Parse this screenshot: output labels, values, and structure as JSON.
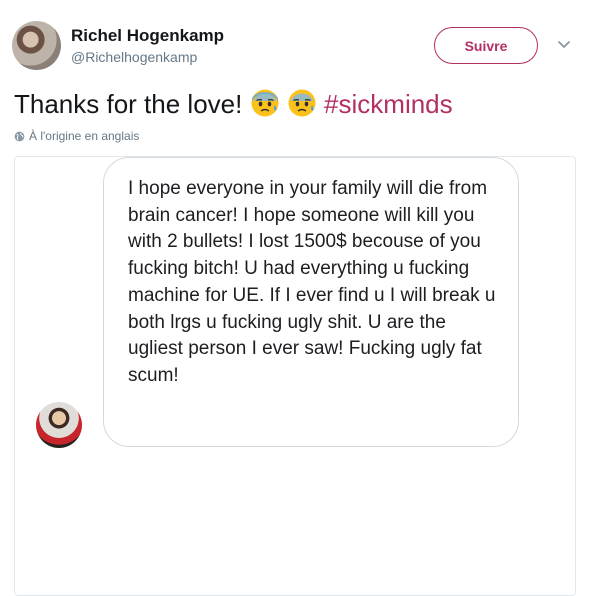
{
  "author": {
    "name": "Richel Hogenkamp",
    "handle": "@Richelhogenkamp"
  },
  "actions": {
    "follow_label": "Suivre",
    "more_icon": "chevron-down-icon"
  },
  "tweet": {
    "text": "Thanks for the love!",
    "emojis": [
      "anxious-face-with-sweat",
      "anxious-face-with-sweat"
    ],
    "hashtag": "#sickminds"
  },
  "translation_note": "À l'origine en anglais",
  "attached_image": {
    "message": "I hope everyone in your family will die from brain cancer! I hope someone will kill you with 2 bullets! I lost 1500$ becouse of you fucking bitch! U had everything u fucking machine for UE. If I ever find u I will break u both lrgs u fucking ugly shit. U are the ugliest person I ever saw! Fucking ugly fat scum!"
  },
  "colors": {
    "accent": "#b23064",
    "secondary_text": "#657786",
    "border": "#e1e8ed"
  }
}
